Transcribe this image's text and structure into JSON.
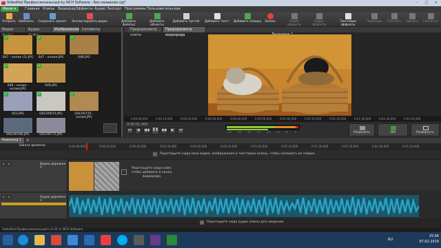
{
  "window": {
    "title": "VideoPad Профессиональный by NCH Software - Без названия.vpj*",
    "controls": [
      "–",
      "□",
      "✕"
    ]
  },
  "menubar": {
    "menu_button": "Меню ▾",
    "items": [
      "Главная",
      "Клипы",
      "Видеоряд",
      "Эффекты",
      "Аудио",
      "Экспорт",
      "Программы",
      "Пользовательская"
    ]
  },
  "toolbar": {
    "buttons": [
      {
        "label": "Открыть",
        "icon": "open-folder-icon",
        "color": "#e8a84a"
      },
      {
        "label": "Шаблоны",
        "icon": "templates-icon",
        "color": "#6a8fc8"
      },
      {
        "label": "Сохранить проект",
        "icon": "save-icon",
        "color": "#5fa0d8"
      },
      {
        "label": "Экспортировать видео",
        "icon": "export-icon",
        "color": "#e05050"
      },
      {
        "label": "Добавить файл(ы)",
        "icon": "add-file-icon",
        "color": "#4fa84f"
      },
      {
        "label": "Добавить объекты",
        "icon": "add-objects-icon",
        "color": "#4fa84f"
      },
      {
        "label": "Добавить пустой",
        "icon": "add-blank-icon",
        "color": "#d0d0d0"
      },
      {
        "label": "Добавить текст",
        "icon": "text-icon",
        "color": "#e0e0e0"
      },
      {
        "label": "Добавить плашку",
        "icon": "add-slide-icon",
        "color": "#4fa84f"
      },
      {
        "label": "Запись",
        "icon": "record-icon",
        "color": "#e04040"
      },
      {
        "label": "Видео эффекты",
        "icon": "video-effects-icon",
        "color": "#777"
      },
      {
        "label": "Аудио эффекты",
        "icon": "audio-effects-icon",
        "color": "#777"
      },
      {
        "label": "Текстовые эффекты",
        "icon": "text-effects-icon",
        "color": "#e0e0e0"
      },
      {
        "label": "Переходы",
        "icon": "transitions-icon",
        "color": "#777"
      },
      {
        "label": "Отрезать",
        "icon": "cut-icon",
        "color": "#777"
      },
      {
        "label": "Удалить",
        "icon": "delete-icon",
        "color": "#777"
      },
      {
        "label": "Субтитры",
        "icon": "subtitles-icon",
        "color": "#777"
      }
    ]
  },
  "bin": {
    "tabs": [
      "Видео файлы",
      "Аудио файлы",
      "Изображения",
      "Сегменты"
    ],
    "active_tab": 2,
    "items": [
      {
        "label": "047 - копия (2).JPG",
        "color": "#c89440"
      },
      {
        "label": "047 - копия.JPG",
        "color": "#b88b3a"
      },
      {
        "label": "048.JPG",
        "color": "#a88048"
      },
      {
        "label": "049 - копия - копия.JPG",
        "color": "#d2a456"
      },
      {
        "label": "049.JPG",
        "color": "#b89048"
      },
      {
        "label": "053.JPG",
        "color": "#9aa0b8"
      },
      {
        "label": "DSC00015.JPG",
        "color": "#c8c8c0"
      },
      {
        "label": "DSC00725 - копия.JPG",
        "color": "#b08a50"
      },
      {
        "label": "DSC00766.JPG",
        "color": "#5a6a7a"
      },
      {
        "label": "DSC00772.JPG",
        "color": "#8a8a9a"
      }
    ]
  },
  "preview": {
    "tabs": [
      "Предпросмотр клипа",
      "Предпросмотр видеоряда"
    ],
    "active_tab": 1,
    "sequence_title": "Видеоряд 1",
    "ruler_times": [
      "0:00:00,000",
      "0:00:10,000",
      "0:00:20,000",
      "0:00:30,000",
      "0:00:40,000",
      "0:00:50,000",
      "0:01:00,000",
      "0:01:10,000",
      "0:01:20,000",
      "0:01:30,000",
      "0:01:40,000",
      "0:01:50,000",
      "0:02:00,000"
    ],
    "time_display": "0:00:01,005",
    "meter_scale": [
      "-42",
      "-36",
      "-30",
      "-24",
      "-18",
      "-12",
      "-6",
      "0"
    ],
    "split_label": "Разделить",
    "fps_badge": "360",
    "fullscreen_label": "Развернуть"
  },
  "timeline": {
    "tab_label": "Видеоряд 1",
    "scale_label": "Шкала времени",
    "ruler_times": [
      "0:00:00,000",
      "0:00:10,000",
      "0:00:20,000",
      "0:00:30,000",
      "0:00:40,000",
      "0:00:50,000",
      "0:01:00,000",
      "0:01:10,000",
      "0:01:20,000",
      "0:01:30,000",
      "0:01:40,000",
      "0:01:50,000",
      "0:02:00,000"
    ],
    "video_drop_hint": "Перетащите сюда свои видео, изображения и текстовые клипы, чтобы наложить их поверх",
    "video_track_label": "Видео дорожка 1",
    "clip_hint": "Перетащите сюда клип, чтобы добавить в конец видеоряда",
    "audio_track_label": "Аудио дорожка 1",
    "audio_drop_hint": "Перетащите сюда аудио клипы для сведения"
  },
  "status": {
    "text": "VideoPad Профессиональный v 6.32 © NCH Software"
  },
  "taskbar": {
    "time": "15:56",
    "date": "07.02.2019",
    "lang": "RU"
  },
  "colors": {
    "accent_green": "#3e9a3e",
    "playhead": "#e02020",
    "waveform": "#27a4c8"
  }
}
